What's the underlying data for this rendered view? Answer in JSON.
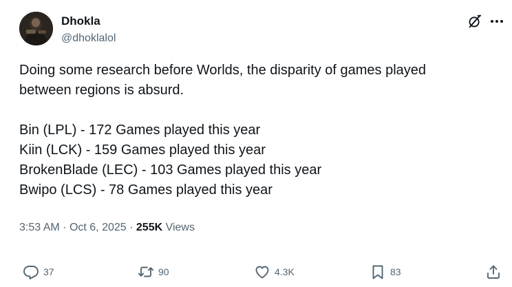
{
  "author": {
    "display_name": "Dhokla",
    "handle": "@dhoklalol"
  },
  "tweet": {
    "intro_lines": [
      "Doing some research before Worlds, the disparity of games played",
      "between regions is absurd."
    ],
    "stat_lines": [
      "Bin (LPL) - 172 Games played this year",
      "Kiin (LCK) - 159 Games played this year",
      "BrokenBlade (LEC) - 103 Games played this year",
      "Bwipo (LCS) - 78 Games played this year"
    ]
  },
  "meta": {
    "time": "3:53 AM",
    "separator": "·",
    "date": "Oct 6, 2025",
    "views_count": "255K",
    "views_label": "Views"
  },
  "actions": {
    "replies": "37",
    "retweets": "90",
    "likes": "4.3K",
    "bookmarks": "83"
  },
  "icons": {
    "grok": "grok-icon",
    "more": "more-icon",
    "reply": "reply-icon",
    "retweet": "retweet-icon",
    "like": "heart-icon",
    "bookmark": "bookmark-icon",
    "share": "share-icon"
  },
  "colors": {
    "text_primary": "#0f1419",
    "text_secondary": "#536471",
    "background": "#ffffff"
  }
}
